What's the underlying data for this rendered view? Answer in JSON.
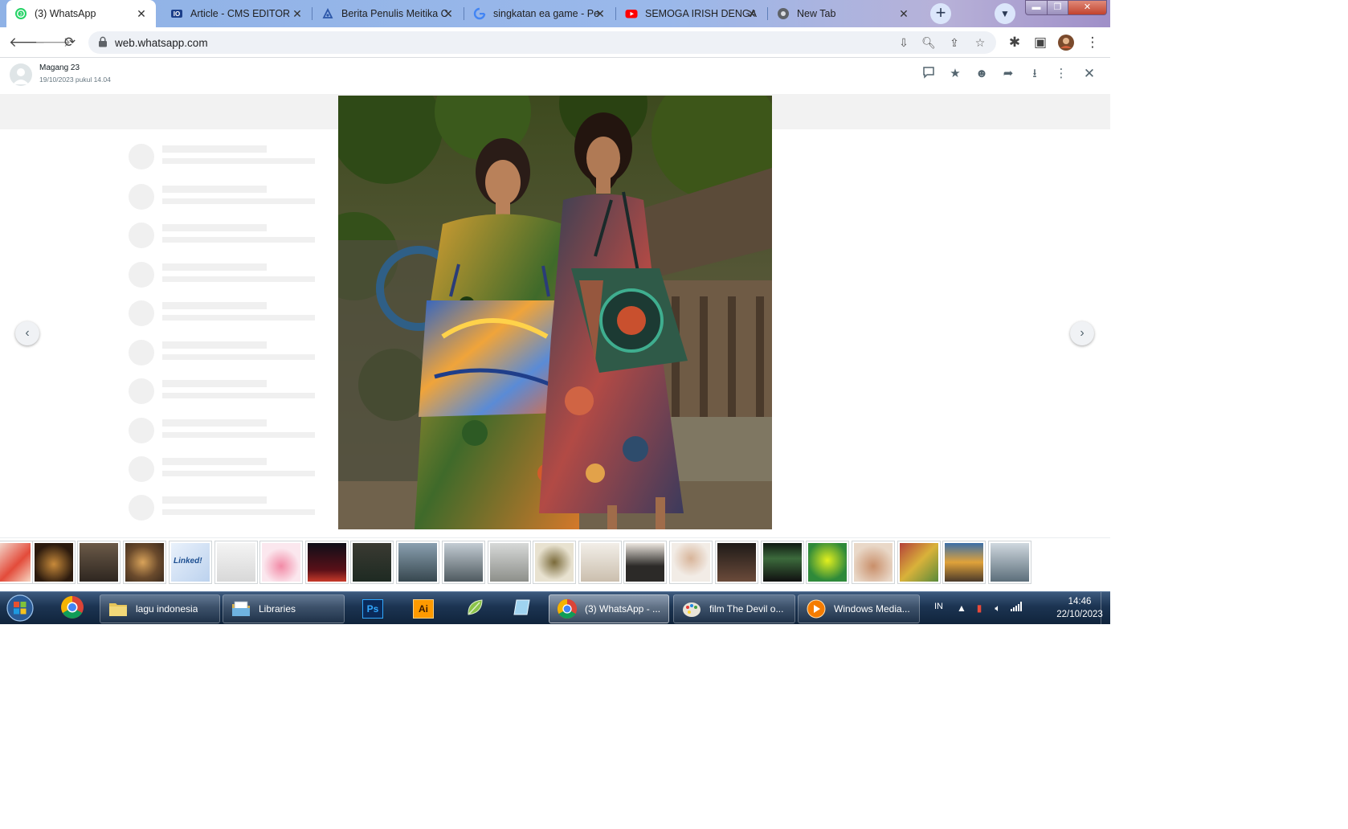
{
  "browser": {
    "tabs": [
      {
        "title": "(3) WhatsApp",
        "icon": "whatsapp-icon",
        "active": true
      },
      {
        "title": "Article - CMS EDITOR",
        "icon": "cms-icon",
        "active": false
      },
      {
        "title": "Berita Penulis Meitika C",
        "icon": "news-icon",
        "active": false
      },
      {
        "title": "singkatan ea game - Pe",
        "icon": "google-icon",
        "active": false
      },
      {
        "title": "SEMOGA IRISH DENGA",
        "icon": "youtube-icon",
        "active": false
      },
      {
        "title": "New Tab",
        "icon": "chrome-icon",
        "active": false
      }
    ],
    "close_glyph": "✕",
    "new_tab_glyph": "+",
    "url": "web.whatsapp.com"
  },
  "viewer": {
    "sender_name": "Magang 23",
    "sender_time": "19/10/2023 pukul 14.04",
    "photo_subject": "Two women holding batik tote bags",
    "thumbnail_text": "Linked!",
    "thumbnail_count": 23
  },
  "taskbar": {
    "apps": [
      {
        "label": "lagu indonesia",
        "icon": "folder-icon"
      },
      {
        "label": "Libraries",
        "icon": "libraries-icon"
      },
      {
        "label": "(3) WhatsApp - ...",
        "icon": "chrome-icon"
      },
      {
        "label": "film The Devil o...",
        "icon": "paint-icon"
      },
      {
        "label": "Windows Media...",
        "icon": "media-player-icon"
      }
    ],
    "pinned": [
      {
        "label": "Ps",
        "icon": "photoshop-icon"
      },
      {
        "label": "Ai",
        "icon": "illustrator-icon"
      }
    ],
    "language": "IN",
    "time": "14:46",
    "date": "22/10/2023"
  },
  "colors": {
    "tabstrip": "#9ab8ea",
    "taskbar": "#1c3452",
    "photoshop": "#0a2a5a",
    "illustrator": "#ff9a00"
  }
}
